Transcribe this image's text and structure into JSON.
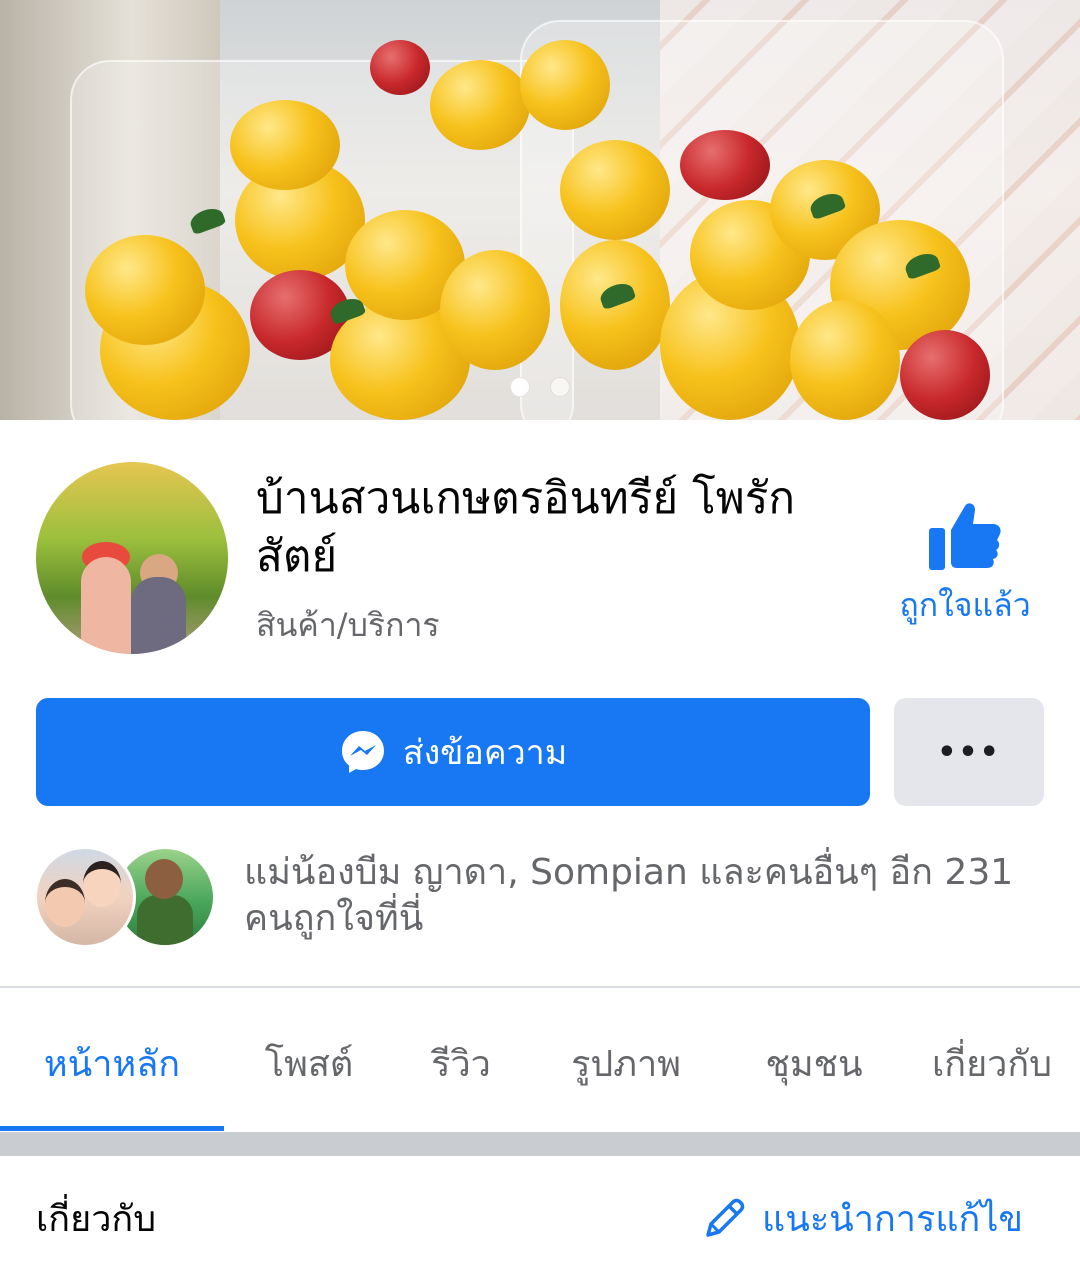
{
  "cover": {
    "carousel_pages": 2,
    "active_page": 1
  },
  "page": {
    "title": "บ้านสวนเกษตรอินทรีย์ โพรักสัตย์",
    "category": "สินค้า/บริการ",
    "liked_label": "ถูกใจแล้ว"
  },
  "actions": {
    "send_message": "ส่งข้อความ",
    "more": "•••"
  },
  "friends": {
    "text": "แม่น้องบีม ญาดา, Sompian และคนอื่นๆ อีก 231 คนถูกใจที่นี่"
  },
  "tabs": [
    {
      "label": "หน้าหลัก",
      "active": true
    },
    {
      "label": "โพสต์",
      "active": false
    },
    {
      "label": "รีวิว",
      "active": false
    },
    {
      "label": "รูปภาพ",
      "active": false
    },
    {
      "label": "ชุมชน",
      "active": false
    },
    {
      "label": "เกี่ยวกับ",
      "active": false
    }
  ],
  "about": {
    "heading": "เกี่ยวกับ",
    "suggest_edit": "แนะนำการแก้ไข"
  },
  "colors": {
    "accent": "#1877f2",
    "secondary_text": "#65676b",
    "button_gray": "#e4e6eb"
  },
  "icons": {
    "like": "thumbs-up-icon",
    "messenger": "messenger-icon",
    "edit": "pencil-icon"
  }
}
